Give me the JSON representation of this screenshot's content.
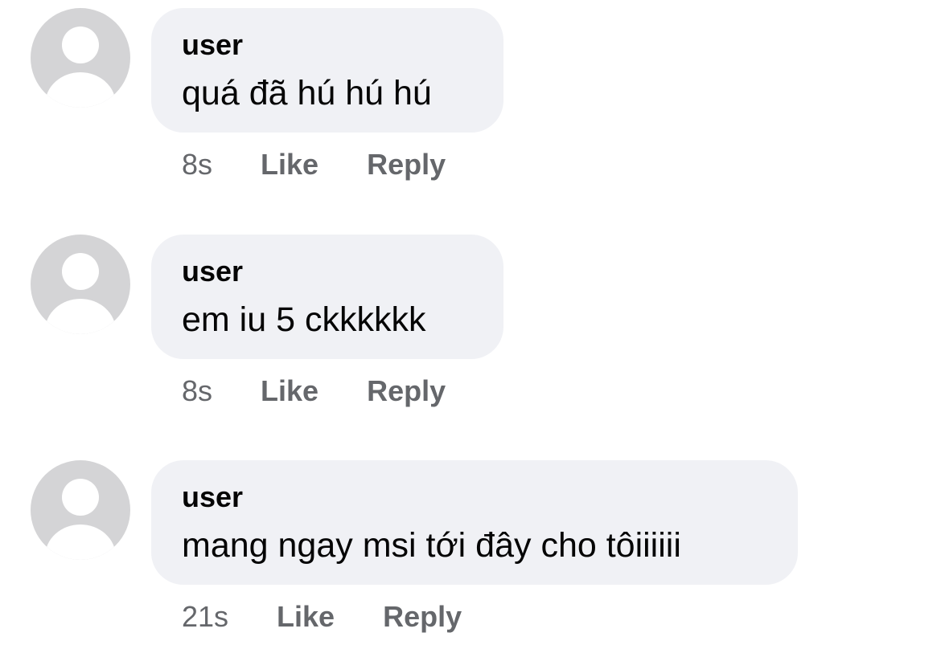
{
  "comments": [
    {
      "author": "user",
      "text": "quá đã hú hú hú",
      "time": "8s",
      "like_label": "Like",
      "reply_label": "Reply",
      "avatar_icon": "default-user-avatar-icon"
    },
    {
      "author": "user",
      "text": "em iu 5 ckkkkkk",
      "time": "8s",
      "like_label": "Like",
      "reply_label": "Reply",
      "avatar_icon": "default-user-avatar-icon"
    },
    {
      "author": "user",
      "text": "mang ngay msi tới đây cho tôiiiiii",
      "time": "21s",
      "like_label": "Like",
      "reply_label": "Reply",
      "avatar_icon": "default-user-avatar-icon"
    }
  ],
  "colors": {
    "bubble_background": "#f0f1f5",
    "avatar_background": "#d4d4d6",
    "avatar_silhouette": "#ffffff",
    "primary_text": "#050505",
    "secondary_text": "#65676b"
  }
}
